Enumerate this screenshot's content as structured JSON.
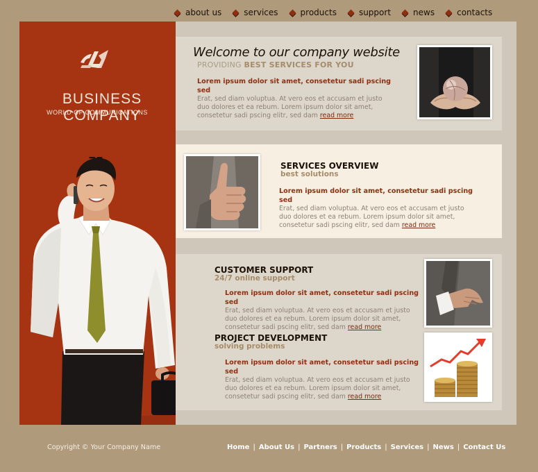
{
  "nav": {
    "items": [
      "about us",
      "services",
      "products",
      "support",
      "news",
      "contacts"
    ]
  },
  "brand": {
    "name": "BUSINESS COMPANY",
    "tagline": "WORLD OF COMMUNICATIONS"
  },
  "welcome": {
    "title": "Welcome to our company website",
    "sub_light": "PROVIDING",
    "sub_bold": "BEST SERVICES FOR YOU",
    "lead": "Lorem ipsum dolor sit amet, consetetur sadi pscing sed",
    "body": "Erat, sed diam voluptua. At vero eos et accusam et justo duo dolores et ea rebum. Lorem ipsum dolor sit amet, consetetur sadi pscing elitr, sed dam",
    "more": "read more"
  },
  "services": {
    "title": "SERVICES OVERVIEW",
    "sub": "best solutions",
    "lead": "Lorem ipsum dolor sit amet, consetetur sadi pscing sed",
    "body": "Erat, sed diam voluptua. At vero eos et accusam et justo duo dolores et ea rebum. Lorem ipsum dolor sit amet, consetetur sadi pscing elitr, sed dam",
    "more": "read more"
  },
  "support": {
    "title": "CUSTOMER SUPPORT",
    "sub": "24/7 online support",
    "lead": "Lorem ipsum dolor sit amet, consetetur sadi pscing sed",
    "body": "Erat, sed diam voluptua. At vero eos et accusam et justo duo dolores et ea rebum. Lorem ipsum dolor sit amet, consetetur sadi pscing elitr, sed dam",
    "more": "read more"
  },
  "project": {
    "title": "PROJECT DEVELOPMENT",
    "sub": "solving problems",
    "lead": "Lorem ipsum dolor sit amet, consetetur sadi pscing sed",
    "body": "Erat, sed diam voluptua. At vero eos et accusam et justo duo dolores et ea rebum. Lorem ipsum dolor sit amet, consetetur sadi pscing elitr, sed dam",
    "more": "read more"
  },
  "footer": {
    "copyright": "Copyright © Your Company Name",
    "links": [
      "Home",
      "About Us",
      "Partners",
      "Products",
      "Services",
      "News",
      "Contact Us"
    ],
    "separator": "|"
  },
  "colors": {
    "page_bg": "#b09a7c",
    "brand_red": "#a63312",
    "lead_red": "#8f2f10",
    "accent_tan": "#a58c6a"
  },
  "icons": {
    "nav_bullet": "diamond-bullet-icon",
    "logo": "company-logo-icon"
  }
}
